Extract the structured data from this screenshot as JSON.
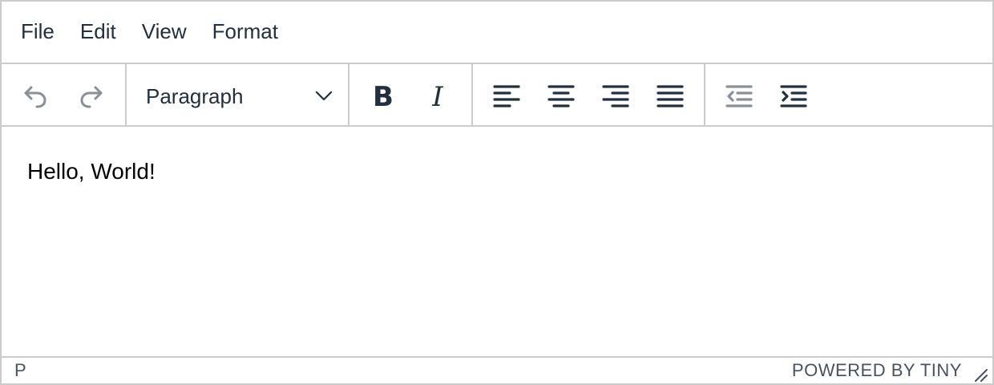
{
  "menubar": {
    "items": [
      {
        "label": "File"
      },
      {
        "label": "Edit"
      },
      {
        "label": "View"
      },
      {
        "label": "Format"
      }
    ]
  },
  "toolbar": {
    "undo_icon": "undo-icon",
    "redo_icon": "redo-icon",
    "blocks": {
      "selected": "Paragraph",
      "icon": "chevron-down-icon"
    },
    "bold_icon": "bold-icon",
    "italic_icon": "italic-icon",
    "align_left_icon": "align-left-icon",
    "align_center_icon": "align-center-icon",
    "align_right_icon": "align-right-icon",
    "align_justify_icon": "align-justify-icon",
    "outdent_icon": "outdent-icon",
    "indent_icon": "indent-icon"
  },
  "content": {
    "paragraph": "Hello, World!"
  },
  "statusbar": {
    "path": "P",
    "branding": "POWERED BY TINY"
  },
  "colors": {
    "border": "#cccccc",
    "text": "#222f3e",
    "disabled_icon": "#8a9099"
  }
}
